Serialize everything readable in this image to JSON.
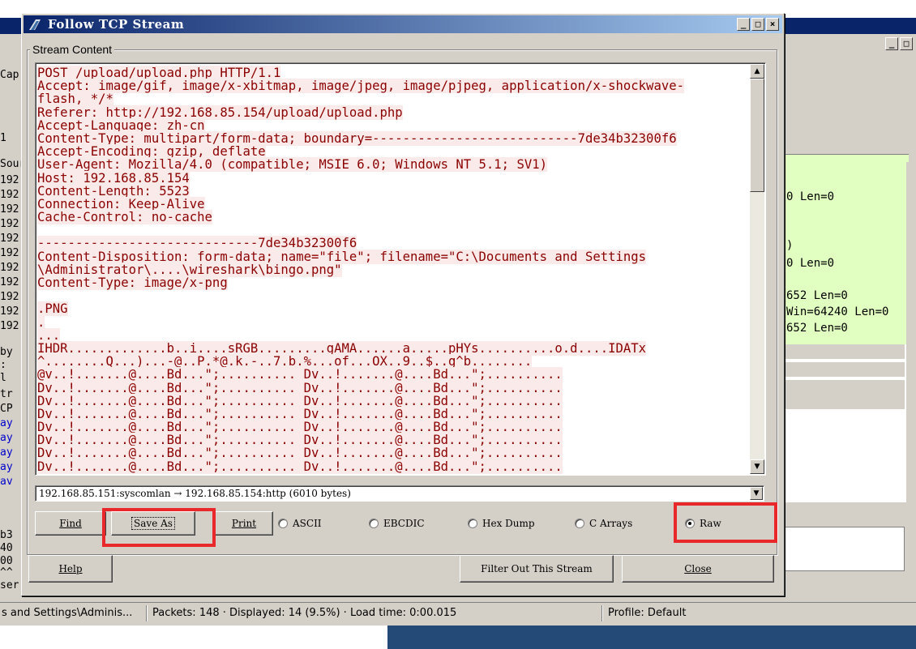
{
  "dialog": {
    "title": "Follow TCP Stream",
    "stream_group_label": "Stream Content",
    "lines": [
      "POST /upload/upload.php HTTP/1.1",
      "Accept: image/gif, image/x-xbitmap, image/jpeg, image/pjpeg, application/x-shockwave-",
      "flash, */*",
      "Referer: http://192.168.85.154/upload/upload.php",
      "Accept-Language: zh-cn",
      "Content-Type: multipart/form-data; boundary=---------------------------7de34b32300f6",
      "Accept-Encoding: gzip, deflate",
      "User-Agent: Mozilla/4.0 (compatible; MSIE 6.0; Windows NT 5.1; SV1)",
      "Host: 192.168.85.154",
      "Content-Length: 5523",
      "Connection: Keep-Alive",
      "Cache-Control: no-cache",
      "",
      "-----------------------------7de34b32300f6",
      "Content-Disposition: form-data; name=\"file\"; filename=\"C:\\Documents and Settings",
      "\\Administrator\\....\\wireshark\\bingo.png\"",
      "Content-Type: image/x-png",
      "",
      ".PNG",
      ".",
      "...",
      "IHDR.............b..i....sRGB.........gAMA......a.....pHYs..........o.d....IDATx",
      "^........Q...)...-@..P.*@.k.-..7.b.%...of...OX..9..$..g^b........",
      "@v..!.......@....Bd...\";.......... Dv..!.......@....Bd...\";..........",
      "Dv..!.......@....Bd...\";.......... Dv..!.......@....Bd...\";..........",
      "Dv..!.......@....Bd...\";.......... Dv..!.......@....Bd...\";..........",
      "Dv..!.......@....Bd...\";.......... Dv..!.......@....Bd...\";..........",
      "Dv..!.......@....Bd...\";.......... Dv..!.......@....Bd...\";..........",
      "Dv..!.......@....Bd...\";.......... Dv..!.......@....Bd...\";..........",
      "Dv..!.......@....Bd...\";.......... Dv..!.......@....Bd...\";..........",
      "Dv..!.......@....Bd...\";.......... Dv..!.......@....Bd...\";.........."
    ],
    "conversation": "192.168.85.151:syscomlan → 192.168.85.154:http (6010 bytes)",
    "buttons": {
      "find": "Find",
      "save_as": "Save As",
      "print": "Print",
      "help": "Help",
      "filter_out": "Filter Out This Stream",
      "close": "Close"
    },
    "radios": [
      {
        "label": "ASCII",
        "checked": false
      },
      {
        "label": "EBCDIC",
        "checked": false
      },
      {
        "label": "Hex Dump",
        "checked": false
      },
      {
        "label": "C Arrays",
        "checked": false
      },
      {
        "label": "Raw",
        "checked": true
      }
    ]
  },
  "background": {
    "left_rows": [
      "Cap",
      "1",
      "Sour",
      "192",
      "192",
      "192",
      "192",
      "192",
      "192",
      "192",
      "192",
      "192",
      "192",
      "192",
      "by",
      ":",
      "l",
      "tr",
      "CP",
      "ay",
      "ay",
      "ay",
      "ay",
      "av",
      "b3",
      "40",
      "00",
      "^^",
      "ser"
    ],
    "right_rows": [
      "0 Len=0",
      ")",
      "0 Len=0",
      "652 Len=0",
      "Win=64240 Len=0",
      "652 Len=0"
    ]
  },
  "status_bar": {
    "file": "s and Settings\\Adminis...",
    "packets": "Packets: 148 · Displayed: 14 (9.5%) · Load time: 0:00.015",
    "profile": "Profile: Default"
  },
  "colors": {
    "stream_text": "#8b0000",
    "stream_bg": "#fbeaea",
    "highlight": "#e8282b",
    "list_green": "#e0ffc0",
    "title_blue": "#0a246a"
  }
}
